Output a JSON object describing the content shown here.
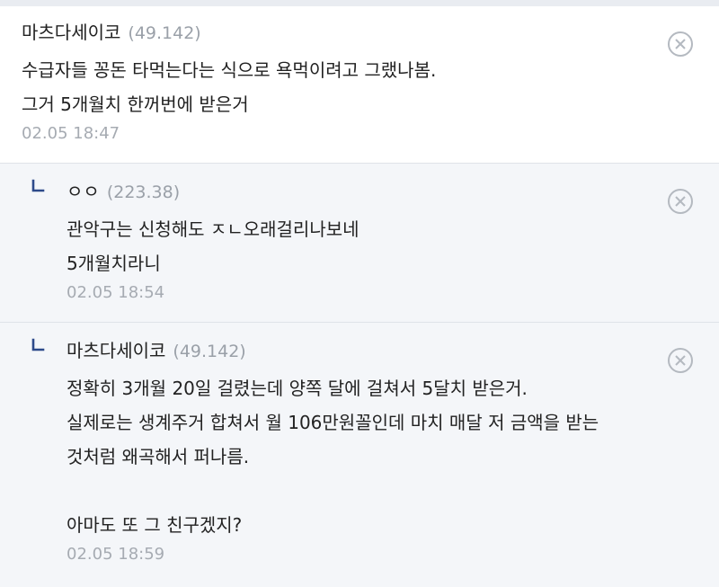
{
  "comments": [
    {
      "author": "마츠다세이코",
      "ip": "(49.142)",
      "lines": [
        "수급자들 꽁돈 타먹는다는 식으로 욕먹이려고 그랬나봄.",
        "그거 5개월치 한꺼번에 받은거"
      ],
      "time": "02.05 18:47"
    }
  ],
  "replies": [
    {
      "author": "ㅇㅇ",
      "ip": "(223.38)",
      "lines": [
        "관악구는 신청해도 ㅈㄴ오래걸리나보네",
        "5개월치라니"
      ],
      "time": "02.05 18:54"
    },
    {
      "author": "마츠다세이코",
      "ip": "(49.142)",
      "lines": [
        "정확히 3개월 20일 걸렸는데 양쪽 달에 걸쳐서 5달치 받은거.",
        "실제로는 생계주거 합쳐서 월 106만원꼴인데 마치 매달 저 금액을 받는",
        "것처럼 왜곡해서 퍼나름.",
        "",
        "아마도 또 그 친구겠지?"
      ],
      "time": "02.05 18:59"
    }
  ],
  "icons": {
    "delete": "close-circle-icon",
    "reply": "reply-arrow-icon"
  },
  "colors": {
    "reply_background": "#f4f6f9",
    "ip_text": "#9aa0a8",
    "reply_mark": "#2d4a8a"
  }
}
